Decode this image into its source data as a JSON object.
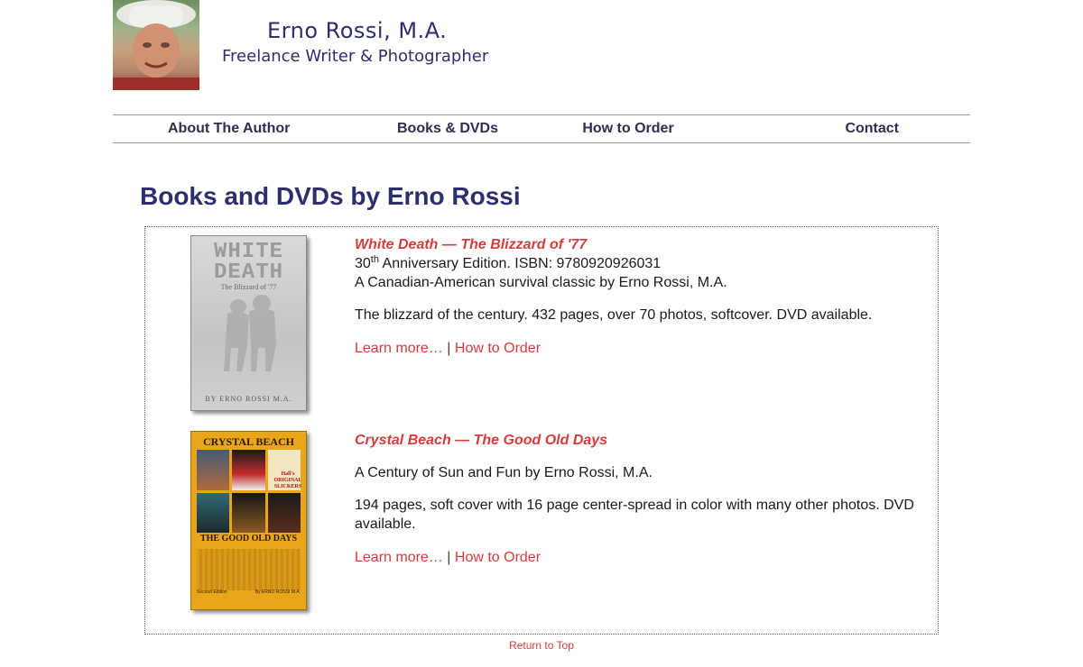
{
  "header": {
    "title": "Erno Rossi, M.A.",
    "subtitle": "Freelance Writer & Photographer"
  },
  "nav": {
    "items": [
      {
        "label": "About The Author"
      },
      {
        "label": "Books & DVDs"
      },
      {
        "label": "How to Order"
      },
      {
        "label": "Contact"
      }
    ]
  },
  "main": {
    "heading": "Books and DVDs by Erno Rossi",
    "products": [
      {
        "title": "White Death — The Blizzard of '77",
        "edition_number": "30",
        "edition_suffix": "th",
        "edition_rest": " Anniversary Edition. ISBN: 9780920926031",
        "tagline": "A Canadian-American survival classic by Erno Rossi, M.A.",
        "description": "The blizzard of the century. 432 pages, over 70 photos, softcover. DVD available.",
        "learn_more": "Learn more…",
        "separator": "|",
        "order_link": "How to Order",
        "cover": {
          "title_line1": "WHITE",
          "title_line2": "DEATH",
          "subtitle": "The Blizzard of '77",
          "author": "BY ERNO ROSSI M.A."
        }
      },
      {
        "title": "Crystal Beach — The Good Old Days",
        "tagline": "A Century of Sun and Fun by Erno Rossi, M.A.",
        "description": "194 pages, soft cover with 16 page center-spread in color with many other photos. DVD available.",
        "learn_more": "Learn more…",
        "separator": "|",
        "order_link": "How to Order",
        "cover": {
          "title": "CRYSTAL BEACH",
          "sign": "Hall's ORIGINAL SLICKERS",
          "bottom_title": "THE GOOD OLD DAYS",
          "edition": "Second Edition",
          "author": "By ERNO ROSSI M.A."
        }
      }
    ]
  },
  "footer": {
    "return_top": "Return to Top"
  },
  "colors": {
    "heading": "#2c2f6b",
    "link": "#d93b3b",
    "nav_text": "#2c2f4f"
  }
}
